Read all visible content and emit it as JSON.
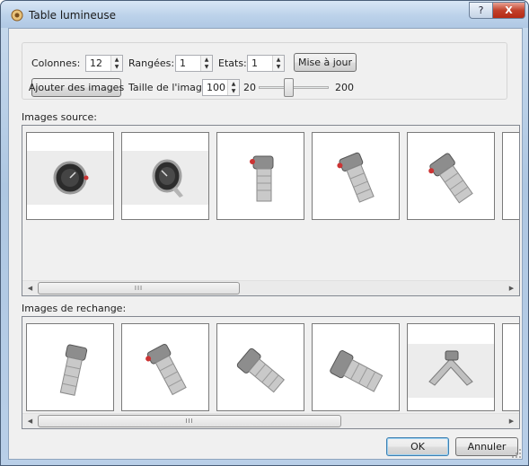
{
  "window": {
    "title": "Table lumineuse",
    "help_label": "?",
    "close_label": "X"
  },
  "controls": {
    "columns_label": "Colonnes:",
    "columns_value": "12",
    "rows_label": "Rangées:",
    "rows_value": "1",
    "states_label": "Etats:",
    "states_value": "1",
    "update_button": "Mise à jour",
    "add_images_button": "Ajouter des images",
    "image_size_label": "Taille de l'image:",
    "image_size_value": "100",
    "slider_min_label": "20",
    "slider_max_label": "200",
    "slider_value": 100
  },
  "source_section": {
    "label": "Images source:",
    "thumbnails": [
      "watch-front-dark",
      "watch-front-angled",
      "watch-side-bracelet",
      "watch-side-tilted",
      "watch-side-crown",
      "watch-partial"
    ],
    "scroll_grip": "III"
  },
  "spare_section": {
    "label": "Images de rechange:",
    "thumbnails": [
      "watch-side-left",
      "watch-side-rotated",
      "watch-lying",
      "watch-lying-bracelet",
      "watch-bracelet-flat",
      "watch-partial"
    ],
    "scroll_grip": "III"
  },
  "footer": {
    "ok_button": "OK",
    "cancel_button": "Annuler"
  },
  "colors": {
    "titlebar": "#bcd2ea",
    "client_bg": "#f0f0f0",
    "close_red": "#c2412b",
    "ok_focus": "#3c7fb1"
  }
}
